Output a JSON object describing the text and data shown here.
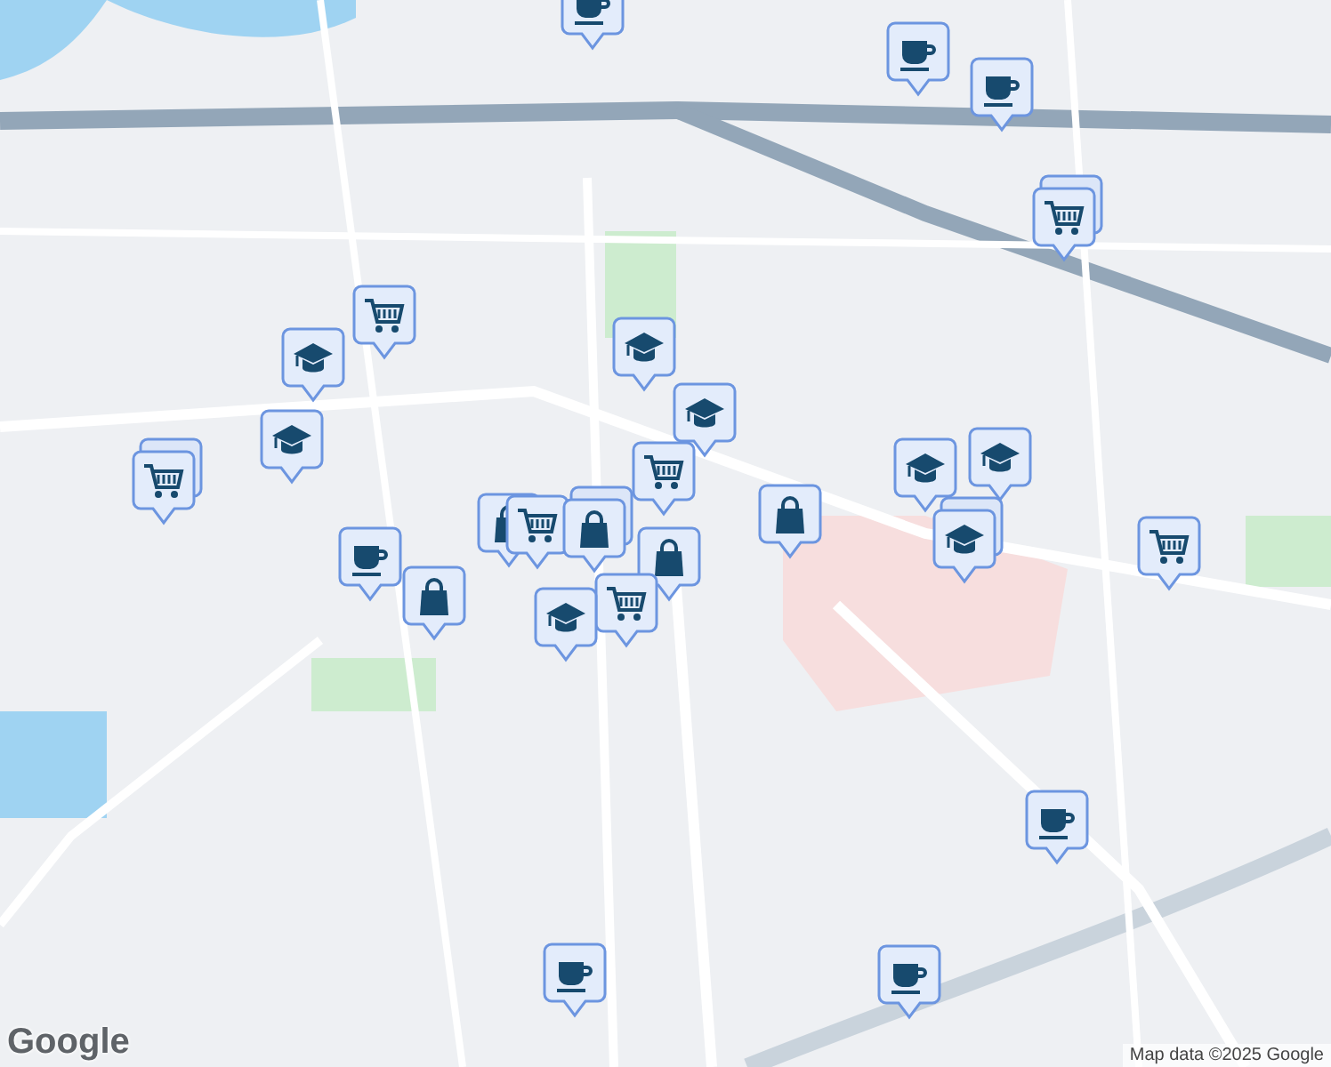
{
  "markers": [
    {
      "kind": "coffee",
      "stacked": false
    },
    {
      "kind": "coffee",
      "stacked": false
    },
    {
      "kind": "coffee",
      "stacked": false
    },
    {
      "kind": "cart",
      "stacked": true
    },
    {
      "kind": "cart",
      "stacked": false
    },
    {
      "kind": "school",
      "stacked": false
    },
    {
      "kind": "school",
      "stacked": false
    },
    {
      "kind": "school",
      "stacked": false
    },
    {
      "kind": "school",
      "stacked": false
    },
    {
      "kind": "cart",
      "stacked": true
    },
    {
      "kind": "cart",
      "stacked": false
    },
    {
      "kind": "school",
      "stacked": false
    },
    {
      "kind": "school",
      "stacked": false
    },
    {
      "kind": "bag",
      "stacked": false
    },
    {
      "kind": "school",
      "stacked": true
    },
    {
      "kind": "cart",
      "stacked": false
    },
    {
      "kind": "coffee",
      "stacked": false
    },
    {
      "kind": "bag",
      "stacked": false
    },
    {
      "kind": "bag",
      "stacked": false
    },
    {
      "kind": "cart",
      "stacked": false
    },
    {
      "kind": "bag",
      "stacked": true
    },
    {
      "kind": "bag",
      "stacked": false
    },
    {
      "kind": "cart",
      "stacked": false
    },
    {
      "kind": "school",
      "stacked": false
    },
    {
      "kind": "coffee",
      "stacked": false
    },
    {
      "kind": "coffee",
      "stacked": false
    },
    {
      "kind": "coffee",
      "stacked": false
    }
  ],
  "logo": "Google",
  "attribution": "Map data ©2025 Google"
}
